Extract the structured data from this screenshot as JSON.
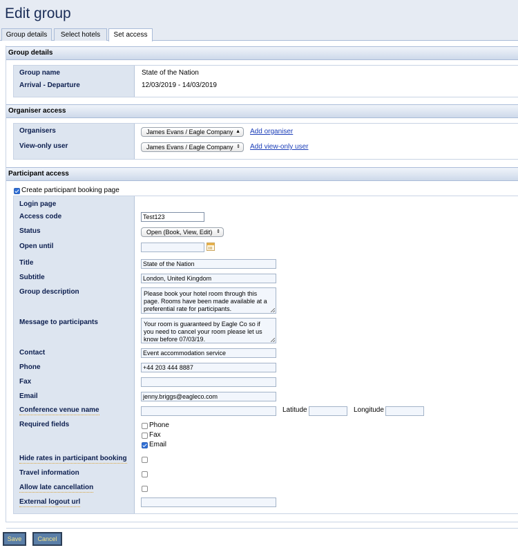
{
  "page_title": "Edit group",
  "tabs": [
    {
      "label": "Group details"
    },
    {
      "label": "Select hotels"
    },
    {
      "label": "Set access"
    }
  ],
  "group_details": {
    "heading": "Group details",
    "group_name_label": "Group name",
    "group_name_value": "State of the Nation",
    "arrival_label": "Arrival - Departure",
    "arrival_value": "12/03/2019 - 14/03/2019"
  },
  "organiser_access": {
    "heading": "Organiser access",
    "organisers_label": "Organisers",
    "organisers_selected": "James Evans / Eagle Company",
    "add_organiser": "Add organiser",
    "viewonly_label": "View-only user",
    "viewonly_selected": "James Evans / Eagle Company",
    "add_viewonly": "Add view-only user"
  },
  "participant_access": {
    "heading": "Participant access",
    "create_page_label": "Create participant booking page",
    "create_page_checked": true,
    "login_page_label": "Login page",
    "access_code_label": "Access code",
    "access_code_value": "Test123",
    "status_label": "Status",
    "status_selected": "Open (Book, View, Edit)",
    "open_until_label": "Open until",
    "open_until_value": "",
    "title_label": "Title",
    "title_value": "State of the Nation",
    "subtitle_label": "Subtitle",
    "subtitle_value": "London, United Kingdom",
    "description_label": "Group description",
    "description_value": "Please book your hotel room through this page. Rooms have been made available at a preferential rate for participants.",
    "message_label": "Message to participants",
    "message_value": "Your room is guaranteed by Eagle Co so if you need to cancel your room please let us know before 07/03/19.",
    "contact_label": "Contact",
    "contact_value": "Event accommodation service",
    "phone_label": "Phone",
    "phone_value": "+44 203 444 8887",
    "fax_label": "Fax",
    "fax_value": "",
    "email_label": "Email",
    "email_value": "jenny.briggs@eagleco.com",
    "venue_label": "Conference venue name",
    "venue_value": "",
    "latitude_label": "Latitude",
    "latitude_value": "",
    "longitude_label": "Longitude",
    "longitude_value": "",
    "required_label": "Required fields",
    "required_options": [
      {
        "label": "Phone",
        "checked": false
      },
      {
        "label": "Fax",
        "checked": false
      },
      {
        "label": "Email",
        "checked": true
      }
    ],
    "hide_rates_label": "Hide rates in participant booking",
    "hide_rates_checked": false,
    "travel_label": "Travel information",
    "travel_checked": false,
    "late_cancel_label": "Allow late cancellation",
    "late_cancel_checked": false,
    "logout_label": "External logout url",
    "logout_value": ""
  },
  "buttons": {
    "save": "Save",
    "cancel": "Cancel"
  },
  "colors": {
    "title_bg": "#e6ebf3",
    "label_column_bg": "#dde5f0",
    "label_text": "#0d1f4f",
    "link": "#1a3db8",
    "button_bg": "#5b7fa8",
    "button_text": "#f3e38a"
  }
}
